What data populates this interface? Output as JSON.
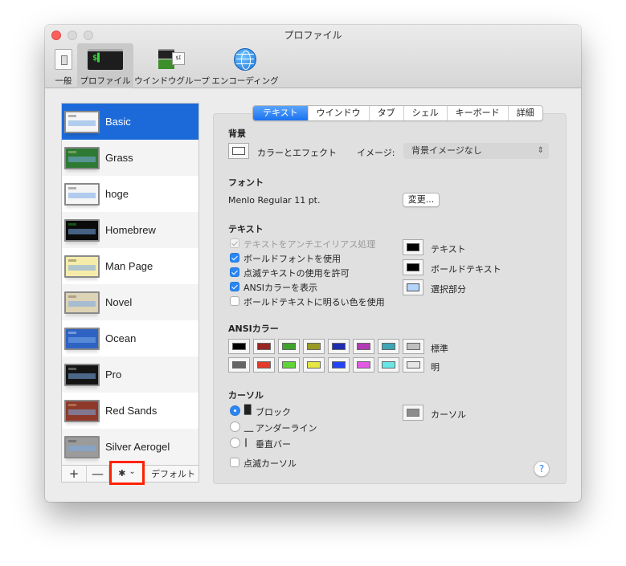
{
  "window": {
    "title": "プロファイル"
  },
  "toolbar": {
    "items": [
      {
        "label": "一般",
        "icon": "general-switch-icon",
        "active": false
      },
      {
        "label": "プロファイル",
        "icon": "terminal-icon",
        "active": true
      },
      {
        "label": "ウインドウグループ",
        "icon": "window-group-icon",
        "active": false
      },
      {
        "label": "エンコーディング",
        "icon": "globe-icon",
        "active": false
      }
    ]
  },
  "profiles": {
    "items": [
      {
        "name": "Basic",
        "selected": true,
        "thumb_bg": "#f5f5f5",
        "thumb_fg": "#333333"
      },
      {
        "name": "Grass",
        "selected": false,
        "thumb_bg": "#2e7a34",
        "thumb_fg": "#f2e6a5"
      },
      {
        "name": "hoge",
        "selected": false,
        "thumb_bg": "#f5f5f5",
        "thumb_fg": "#333333"
      },
      {
        "name": "Homebrew",
        "selected": false,
        "thumb_bg": "#0b0b0b",
        "thumb_fg": "#2cd52c"
      },
      {
        "name": "Man Page",
        "selected": false,
        "thumb_bg": "#f6ecaa",
        "thumb_fg": "#333333"
      },
      {
        "name": "Novel",
        "selected": false,
        "thumb_bg": "#ddd3b5",
        "thumb_fg": "#5a4630"
      },
      {
        "name": "Ocean",
        "selected": false,
        "thumb_bg": "#2e63c4",
        "thumb_fg": "#ffffff"
      },
      {
        "name": "Pro",
        "selected": false,
        "thumb_bg": "#141414",
        "thumb_fg": "#dddddd"
      },
      {
        "name": "Red Sands",
        "selected": false,
        "thumb_bg": "#8e3a2b",
        "thumb_fg": "#e8c890"
      },
      {
        "name": "Silver Aerogel",
        "selected": false,
        "thumb_bg": "#9b9b9b",
        "thumb_fg": "#2a2a2a"
      }
    ],
    "footer": {
      "add_label": "+",
      "remove_label": "—",
      "gear_label": "✱",
      "gear_chevron": "⌄",
      "default_label": "デフォルト"
    }
  },
  "tabs": {
    "items": [
      {
        "label": "テキスト",
        "active": true
      },
      {
        "label": "ウインドウ",
        "active": false
      },
      {
        "label": "タブ",
        "active": false
      },
      {
        "label": "シェル",
        "active": false
      },
      {
        "label": "キーボード",
        "active": false
      },
      {
        "label": "詳細",
        "active": false
      }
    ]
  },
  "background": {
    "title": "背景",
    "color_effect_label": "カラーとエフェクト",
    "color_effect_swatch": "#ffffff",
    "image_label": "イメージ:",
    "image_value": "背景イメージなし",
    "image_arrows": "⌃⌄"
  },
  "font": {
    "title": "フォント",
    "value": "Menlo Regular 11 pt.",
    "change_button": "変更..."
  },
  "text": {
    "title": "テキスト",
    "options": [
      {
        "label": "テキストをアンチエイリアス処理",
        "checked": true,
        "disabled": true
      },
      {
        "label": "ボールドフォントを使用",
        "checked": true,
        "disabled": false
      },
      {
        "label": "点滅テキストの使用を許可",
        "checked": true,
        "disabled": false
      },
      {
        "label": "ANSIカラーを表示",
        "checked": true,
        "disabled": false
      },
      {
        "label": "ボールドテキストに明るい色を使用",
        "checked": false,
        "disabled": false
      }
    ],
    "colors": [
      {
        "label": "テキスト",
        "color": "#000000"
      },
      {
        "label": "ボールドテキスト",
        "color": "#000000"
      },
      {
        "label": "選択部分",
        "color": "#b3d4fb"
      }
    ]
  },
  "ansi": {
    "title": "ANSIカラー",
    "normal_label": "標準",
    "bright_label": "明",
    "normal": [
      "#000000",
      "#992520",
      "#3fa32b",
      "#999926",
      "#1c2db2",
      "#b13ab2",
      "#3ea5b3",
      "#bfbfbf"
    ],
    "bright": [
      "#666666",
      "#e33b2b",
      "#5fd637",
      "#e5e543",
      "#2344f6",
      "#e259e4",
      "#6ae5e6",
      "#e6e6e6"
    ]
  },
  "cursor": {
    "title": "カーソル",
    "styles": [
      {
        "glyph": "█",
        "label": "ブロック",
        "selected": true
      },
      {
        "glyph": "＿",
        "label": "アンダーライン",
        "selected": false
      },
      {
        "glyph": "|",
        "label": "垂直バー",
        "selected": false
      }
    ],
    "blink_label": "点滅カーソル",
    "blink_checked": false,
    "color_label": "カーソル",
    "color": "#8c8c8c"
  },
  "help": {
    "label": "?"
  }
}
